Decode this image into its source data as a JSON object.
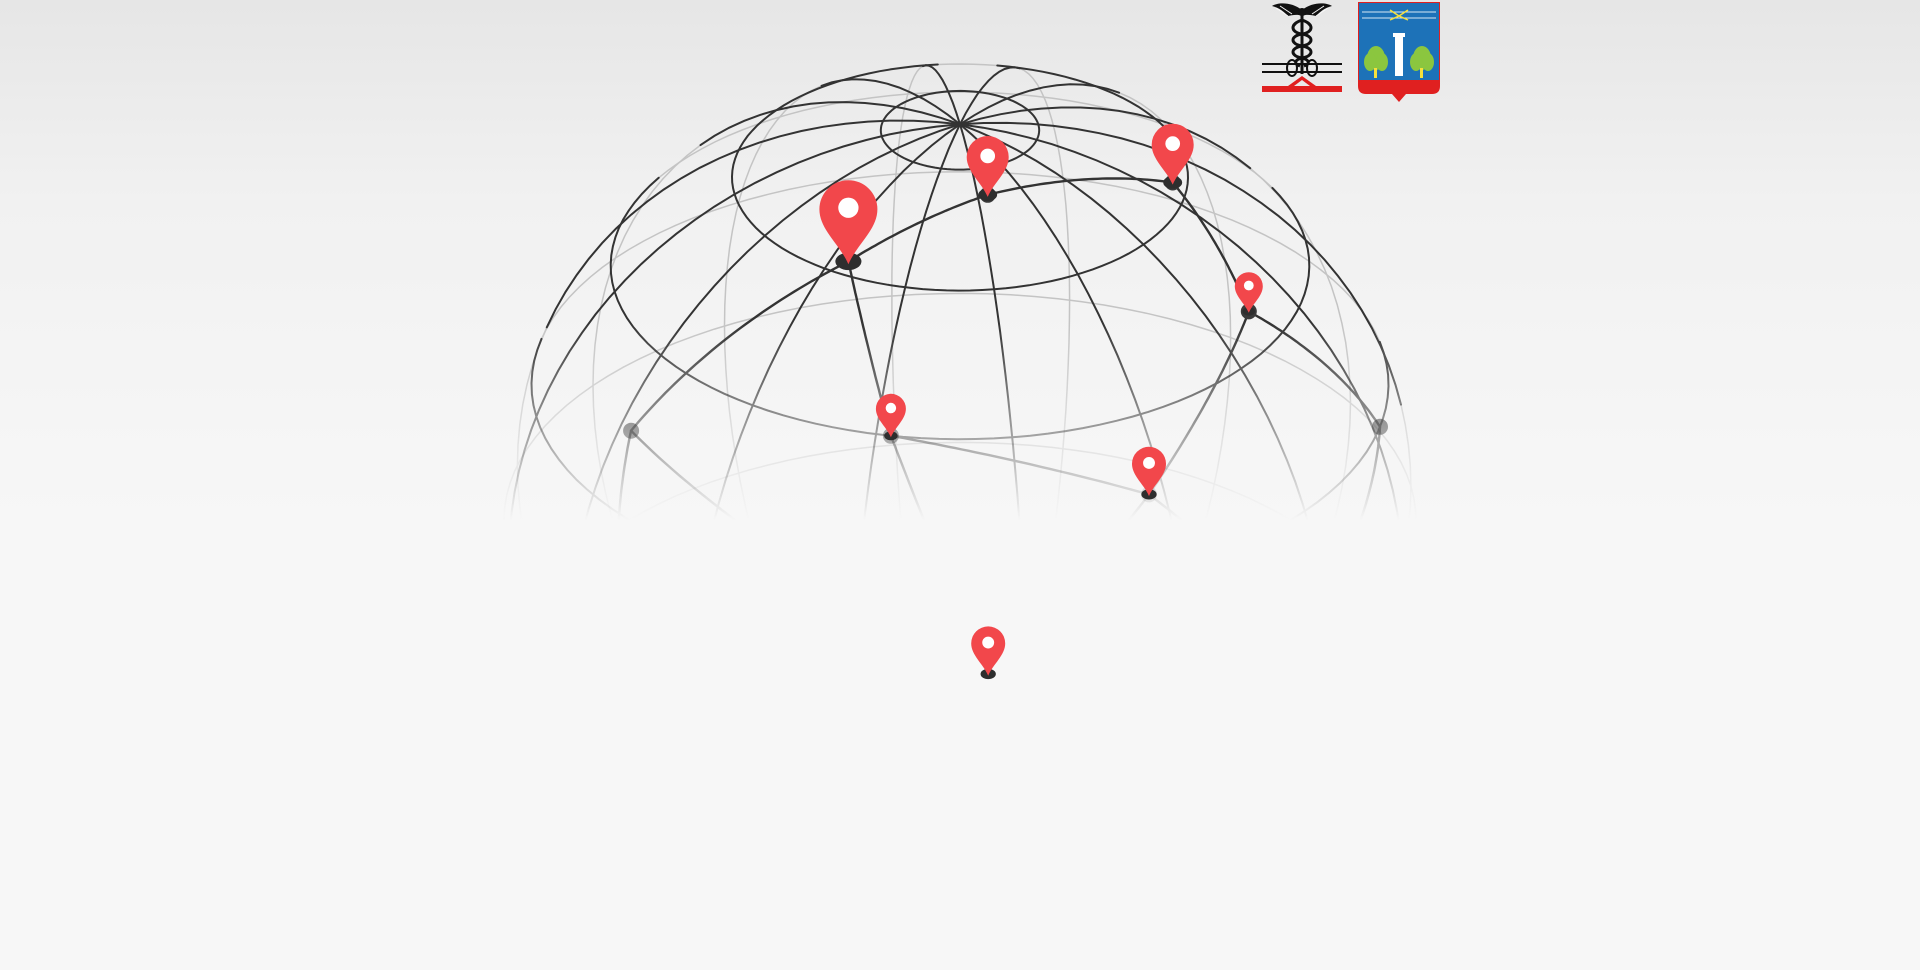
{
  "scene": {
    "description_free": true,
    "background_color": "#f7f7f7",
    "globe_line_color": "#333333",
    "pin_color": "#f2474b",
    "pin_count": 7
  },
  "logos": {
    "emblem": {
      "icon": "caduceus-emblem-icon",
      "accent_color": "#e02020"
    },
    "crest": {
      "icon": "city-coat-of-arms-icon",
      "field_color": "#1d72b8",
      "base_color": "#e02020",
      "tree_color": "#8bc63f"
    }
  }
}
